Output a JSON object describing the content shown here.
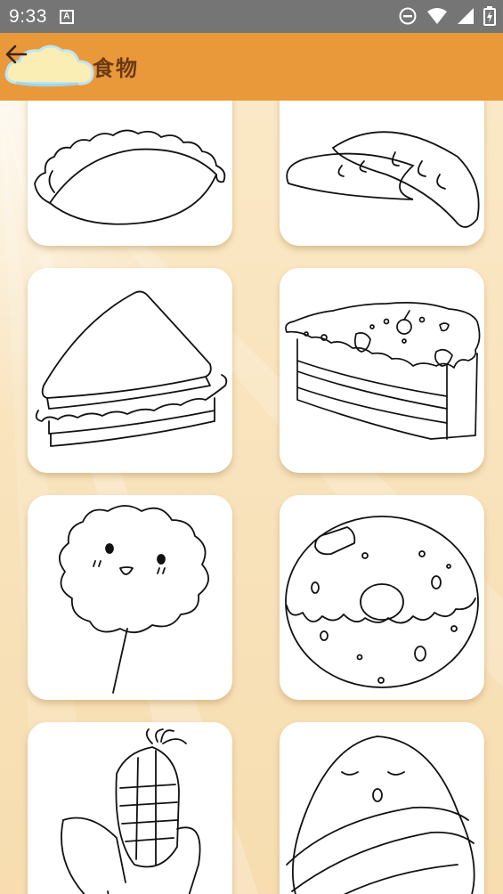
{
  "status_bar": {
    "time": "9:33",
    "notification_icon": "A"
  },
  "header": {
    "title": "食物",
    "back_icon": "arrow-left-icon"
  },
  "grid": {
    "items": [
      {
        "icon": "dumpling-drawing"
      },
      {
        "icon": "bread-drawing"
      },
      {
        "icon": "sandwich-drawing"
      },
      {
        "icon": "cake-slice-drawing"
      },
      {
        "icon": "cotton-candy-drawing"
      },
      {
        "icon": "donut-drawing"
      },
      {
        "icon": "corn-drawing"
      },
      {
        "icon": "rice-dumpling-drawing"
      }
    ]
  },
  "colors": {
    "app_bar": "#e9993a",
    "title": "#6b3a13",
    "background": "#f9e6c4"
  }
}
